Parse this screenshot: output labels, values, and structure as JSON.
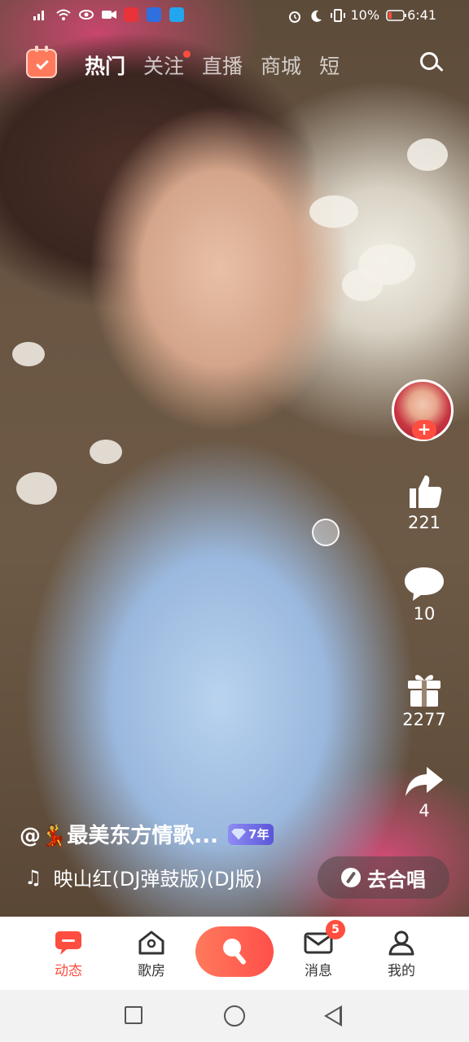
{
  "status_bar": {
    "battery": "10%",
    "time": "6:41"
  },
  "top_nav": {
    "tabs": [
      {
        "label": "热门",
        "active": true
      },
      {
        "label": "关注",
        "has_dot": true
      },
      {
        "label": "直播"
      },
      {
        "label": "商城"
      },
      {
        "label": "短"
      }
    ]
  },
  "video": {
    "author": "@💃最美东方情歌...",
    "vip_years_label": "7年",
    "song": "映山红(DJ弹鼓版)(DJ版)",
    "chorus_button": "去合唱"
  },
  "actions": {
    "follow_plus": "+",
    "likes": "221",
    "comments": "10",
    "gifts": "2277",
    "shares": "4"
  },
  "tab_bar": {
    "items": [
      {
        "label": "动态",
        "active": true
      },
      {
        "label": "歌房"
      },
      {
        "label": "消息",
        "badge": "5"
      },
      {
        "label": "我的"
      }
    ]
  },
  "colors": {
    "accent": "#ff4d3f",
    "tab_active": "#ff4d3f",
    "vip": "#6b67e0"
  }
}
